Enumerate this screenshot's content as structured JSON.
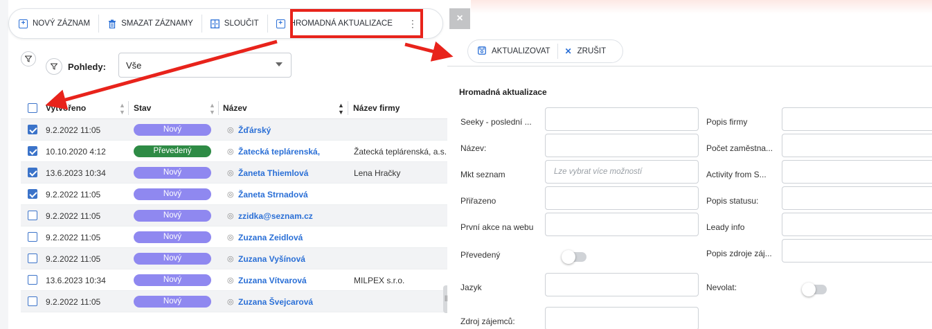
{
  "toolbar": {
    "new_record": "NOVÝ ZÁZNAM",
    "delete_records": "SMAZAT ZÁZNAMY",
    "merge": "SLOUČIT",
    "mass_update": "HROMADNÁ AKTUALIZACE",
    "more": "⋮"
  },
  "views": {
    "label": "Pohledy:",
    "selected": "Vše"
  },
  "table": {
    "headers": {
      "created": "Vytvořeno",
      "status": "Stav",
      "name": "Název",
      "company": "Název firmy"
    },
    "rows": [
      {
        "checked": true,
        "date": "9.2.2022 11:05",
        "status": "Nový",
        "status_color": "#8f88f0",
        "name": "Žďárský",
        "company": ""
      },
      {
        "checked": true,
        "date": "10.10.2020 4:12",
        "status": "Převedený",
        "status_color": "#2e8b45",
        "name": "Žatecká teplárenská,",
        "company": "Žatecká teplárenská, a.s."
      },
      {
        "checked": true,
        "date": "13.6.2023 10:34",
        "status": "Nový",
        "status_color": "#8f88f0",
        "name": "Žaneta Thiemlová",
        "company": "Lena Hračky"
      },
      {
        "checked": true,
        "date": "9.2.2022 11:05",
        "status": "Nový",
        "status_color": "#8f88f0",
        "name": "Žaneta Strnadová",
        "company": ""
      },
      {
        "checked": false,
        "date": "9.2.2022 11:05",
        "status": "Nový",
        "status_color": "#8f88f0",
        "name": "zzidka@seznam.cz",
        "company": ""
      },
      {
        "checked": false,
        "date": "9.2.2022 11:05",
        "status": "Nový",
        "status_color": "#8f88f0",
        "name": "Zuzana Zeidlová",
        "company": ""
      },
      {
        "checked": false,
        "date": "9.2.2022 11:05",
        "status": "Nový",
        "status_color": "#8f88f0",
        "name": "Zuzana Vyšínová",
        "company": ""
      },
      {
        "checked": false,
        "date": "13.6.2023 10:34",
        "status": "Nový",
        "status_color": "#8f88f0",
        "name": "Zuzana Vítvarová",
        "company": "MILPEX s.r.o."
      },
      {
        "checked": false,
        "date": "9.2.2022 11:05",
        "status": "Nový",
        "status_color": "#8f88f0",
        "name": "Zuzana Švejcarová",
        "company": ""
      }
    ]
  },
  "panel": {
    "close": "×",
    "update_button": "AKTUALIZOVAT",
    "cancel_button": "ZRUŠIT",
    "title": "Hromadná aktualizace",
    "left_fields": [
      {
        "label": "Seeky - poslední ...",
        "type": "input",
        "placeholder": ""
      },
      {
        "label": "Název:",
        "type": "input",
        "placeholder": ""
      },
      {
        "label": "Mkt seznam",
        "type": "input",
        "placeholder": "Lze vybrat více možností"
      },
      {
        "label": "Přiřazeno",
        "type": "input",
        "placeholder": ""
      },
      {
        "label": "První akce na webu",
        "type": "input",
        "placeholder": ""
      },
      {
        "label": "Převedený",
        "type": "toggle",
        "placeholder": ""
      },
      {
        "label": "Jazyk",
        "type": "input",
        "placeholder": ""
      },
      {
        "label": "Zdroj zájemců:",
        "type": "input",
        "placeholder": ""
      }
    ],
    "right_fields": [
      {
        "label": "Popis firmy",
        "type": "input"
      },
      {
        "label": "Počet zaměstna...",
        "type": "input"
      },
      {
        "label": "Activity from S...",
        "type": "input"
      },
      {
        "label": "Popis statusu:",
        "type": "input"
      },
      {
        "label": "Leady info",
        "type": "input"
      },
      {
        "label": "Popis zdroje záj...",
        "type": "input"
      },
      {
        "label": "Nevolat:",
        "type": "toggle"
      }
    ]
  },
  "colors": {
    "accent": "#2a6fd6",
    "annotation_red": "#e8231b"
  }
}
